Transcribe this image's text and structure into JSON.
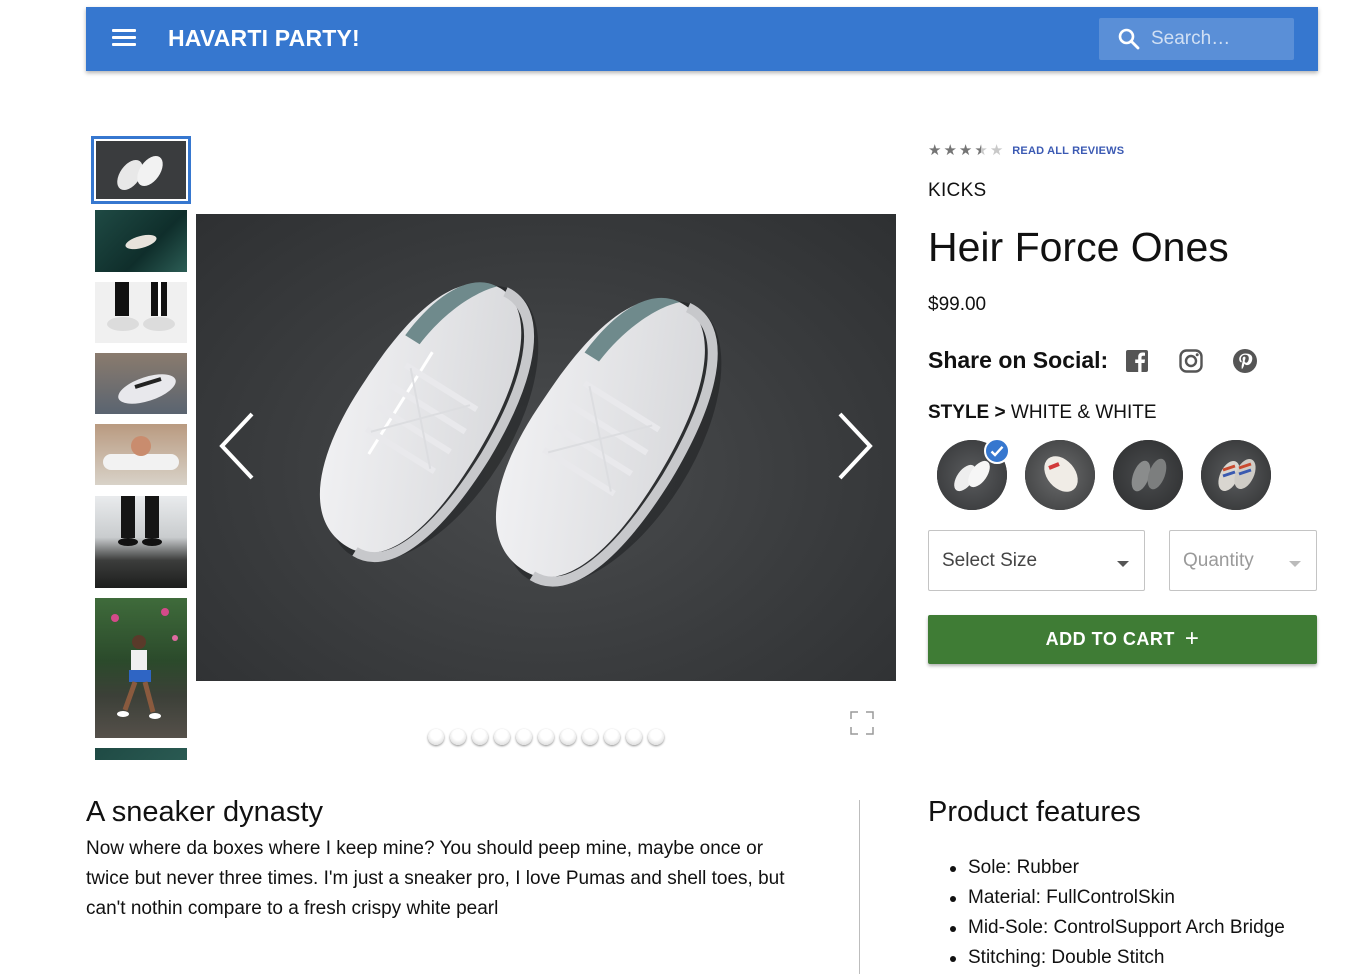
{
  "header": {
    "brand": "HAVARTI PARTY!",
    "search_placeholder": "Search…",
    "bar_color": "#3677cf"
  },
  "gallery": {
    "thumbnail_count": 8,
    "active_thumbnail": 1,
    "slide_count": 11,
    "active_slide": 1
  },
  "product": {
    "rating": 3.5,
    "rating_max": 5,
    "reviews_link": "READ ALL REVIEWS",
    "category": "KICKS",
    "name": "Heir Force Ones",
    "price": "$99.00",
    "share_label": "Share on Social:",
    "social_icons": [
      "facebook-icon",
      "instagram-icon",
      "pinterest-icon"
    ],
    "style_label": "STYLE >",
    "style_value": "WHITE & WHITE",
    "styles_count": 4,
    "selected_style": 1,
    "size_select": "Select Size",
    "quantity_select": "Quantity",
    "add_to_cart": "ADD TO CART",
    "add_icon": "+",
    "cart_color": "#3f7c35"
  },
  "description": {
    "title": "A sneaker dynasty",
    "body": "Now where da boxes where I keep mine? You should peep mine, maybe once or twice but never three times. I'm just a sneaker pro, I love Pumas and shell toes, but can't nothin compare to a fresh crispy white pearl"
  },
  "features": {
    "title": "Product features",
    "items": [
      "Sole: Rubber",
      "Material: FullControlSkin",
      "Mid-Sole: ControlSupport Arch Bridge",
      "Stitching: Double Stitch"
    ]
  }
}
